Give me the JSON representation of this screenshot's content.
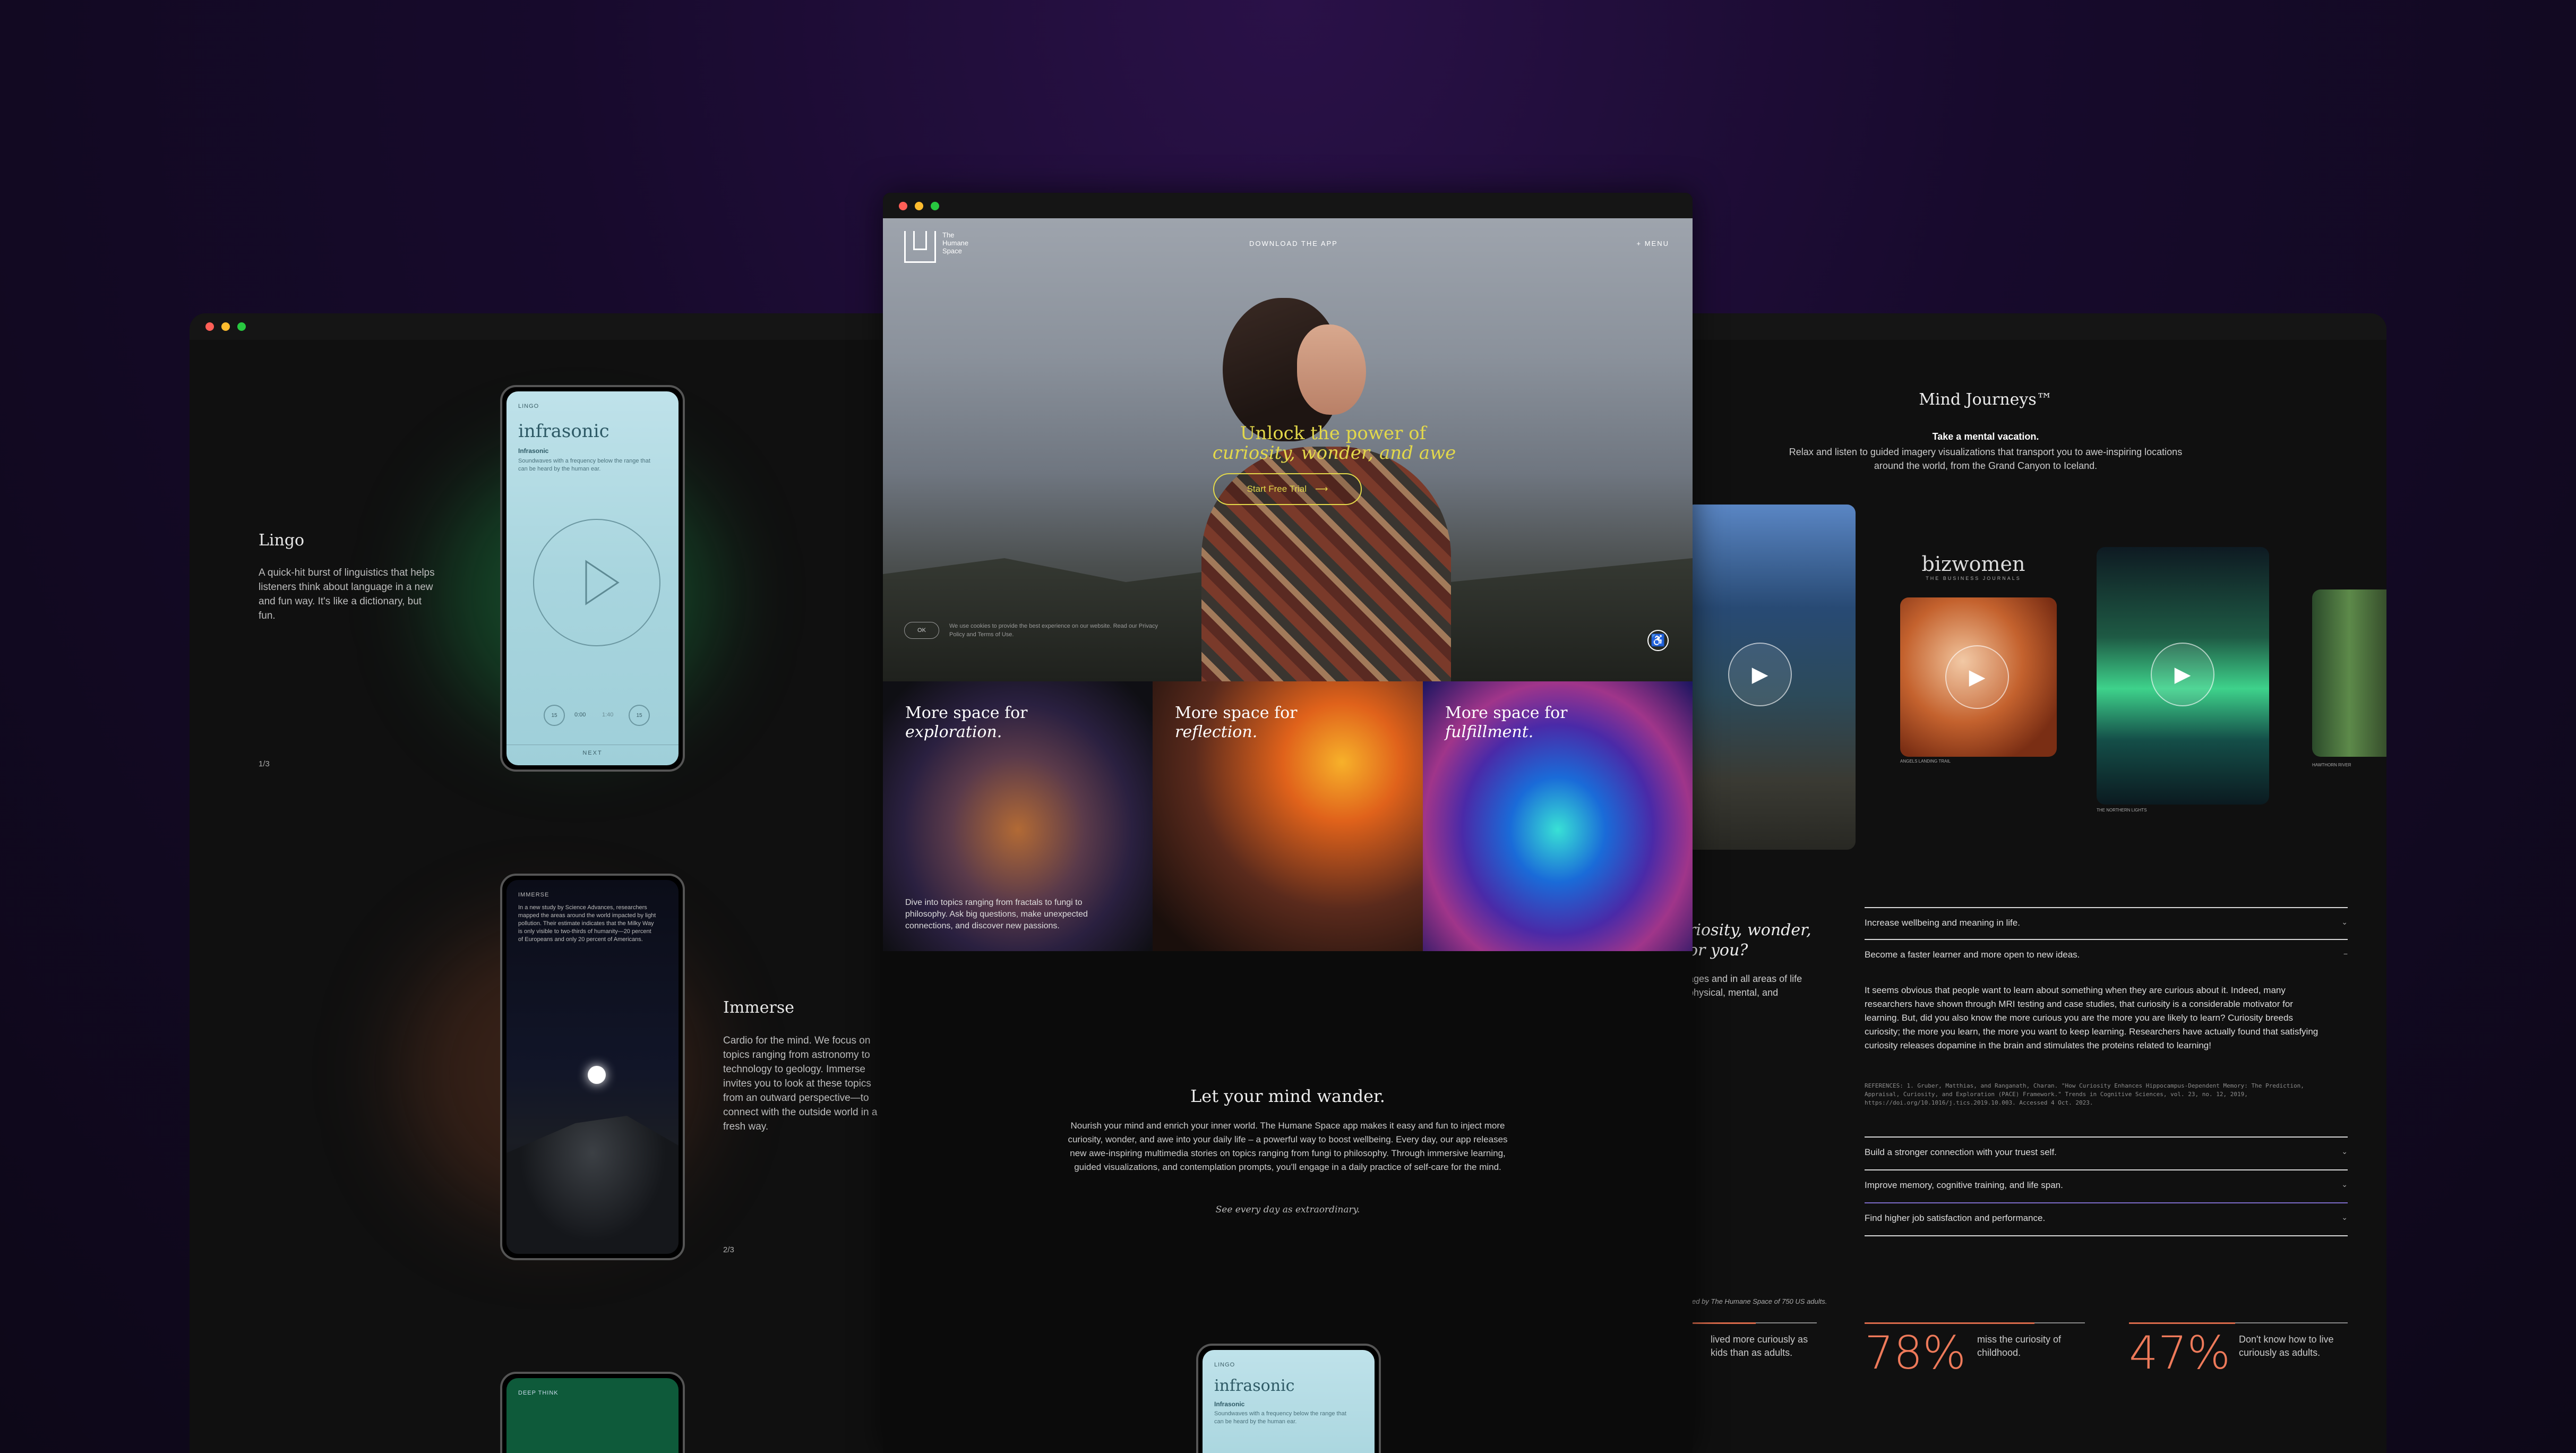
{
  "back_window": {
    "lingo": {
      "title": "Lingo",
      "desc": "A quick-hit burst of linguistics that helps listeners think about language in a new and fun way. It's like a dictionary, but fun.",
      "pager": "1/3"
    },
    "phone1": {
      "label": "LINGO",
      "word": "infrasonic",
      "sub": "Infrasonic",
      "body": "Soundwaves with a frequency below the range that can be heard by the human ear.",
      "time_left": "0:00",
      "time_right": "1:40",
      "next": "NEXT"
    },
    "immerse": {
      "title": "Immerse",
      "desc": "Cardio for the mind. We focus on topics ranging from astronomy to technology to geology. Immerse invites you to look at these topics from an outward perspective—to connect with the outside world in a fresh way.",
      "pager": "2/3"
    },
    "phone2": {
      "label": "IMMERSE",
      "body": "In a new study by Science Advances, researchers mapped the areas around the world impacted by light pollution. Their estimate indicates that the Milky Way is only visible to two-thirds of humanity—20 percent of Europeans and only 20 percent of Americans."
    },
    "phone3": {
      "label": "DEEP THINK"
    },
    "mind_journeys": {
      "title": "Mind Journeys™",
      "sub": "Take a mental vacation.",
      "desc": "Relax and listen to guided imagery visualizations that transport you to awe-inspiring locations around the world, from the Grand Canyon to Iceland.",
      "brand": "bizwomen",
      "brand_sub": "THE BUSINESS JOURNALS",
      "cap1": "ANGELS LANDING TRAIL",
      "cap2": "THE NORTHERN LIGHTS",
      "cap3": "HAWTHORN RIVER"
    },
    "curiosity": {
      "title_line1": "riosity, wonder,",
      "title_line2": "or you?",
      "desc_line1": "ages and in all areas of life",
      "desc_line2": "physical, mental, and"
    },
    "accordion": {
      "items": [
        "Increase wellbeing and meaning in life.",
        "Become a faster learner and more open to new ideas.",
        "Build a stronger connection with your truest self.",
        "Improve memory, cognitive training, and life span.",
        "Find higher job satisfaction and performance."
      ],
      "open_body": "It seems obvious that people want to learn about something when they are curious about it. Indeed, many researchers have shown through MRI testing and case studies, that curiosity is a considerable motivator for learning. But, did you also know the more curious you are the more you are likely to learn? Curiosity breeds curiosity; the more you learn, the more you want to keep learning. Researchers have actually found that satisfying curiosity releases dopamine in the brain and stimulates the proteins related to learning!",
      "ref": "REFERENCES: 1. Gruber, Matthias, and Ranganath, Charan. \"How Curiosity Enhances Hippocampus-Dependent Memory: The Prediction, Appraisal, Curiosity, and Exploration (PACE) Framework.\" Trends in Cognitive Sciences, vol. 23, no. 12, 2019, https://doi.org/10.1016/j.tics.2019.10.003. Accessed 4 Oct. 2023."
    },
    "stats": {
      "source": "ed by The Humane Space of 750 US adults.",
      "items": [
        {
          "num": "",
          "text": "lived more curiously as kids than as adults."
        },
        {
          "num": "78%",
          "text": "miss the curiosity of childhood."
        },
        {
          "num": "47%",
          "text": "Don't know how to live curiously as adults."
        }
      ]
    }
  },
  "front_window": {
    "logo_text": "The Humane Space",
    "nav_download": "DOWNLOAD THE APP",
    "nav_menu": "+ MENU",
    "hero_line1": "Unlock the power of",
    "hero_line2": "curiosity, wonder, and awe",
    "cta": "Start Free Trial",
    "cookie_ok": "OK",
    "cookie_text": "We use cookies to provide the best experience on our website. Read our Privacy Policy and Terms of Use.",
    "tiles": [
      {
        "line1": "More space for",
        "line2": "exploration.",
        "desc": "Dive into topics ranging from fractals to fungi to philosophy. Ask big questions, make unexpected connections, and discover new passions."
      },
      {
        "line1": "More space for",
        "line2": "reflection.",
        "desc": ""
      },
      {
        "line1": "More space for",
        "line2": "fulfillment.",
        "desc": ""
      }
    ],
    "wander_title": "Let your mind wander.",
    "wander_body": "Nourish your mind and enrich your inner world. The Humane Space app makes it easy and fun to inject more curiosity, wonder, and awe into your daily life – a powerful way to boost wellbeing. Every day, our app releases new awe-inspiring multimedia stories on topics ranging from fungi to philosophy. Through immersive learning, guided visualizations, and contemplation prompts, you'll engage in a daily practice of self-care for the mind.",
    "wander_tag": "See every day as extraordinary.",
    "bottom_phone": {
      "label": "LINGO",
      "word": "infrasonic",
      "sub": "Infrasonic",
      "body": "Soundwaves with a frequency below the range that can be heard by the human ear."
    }
  }
}
